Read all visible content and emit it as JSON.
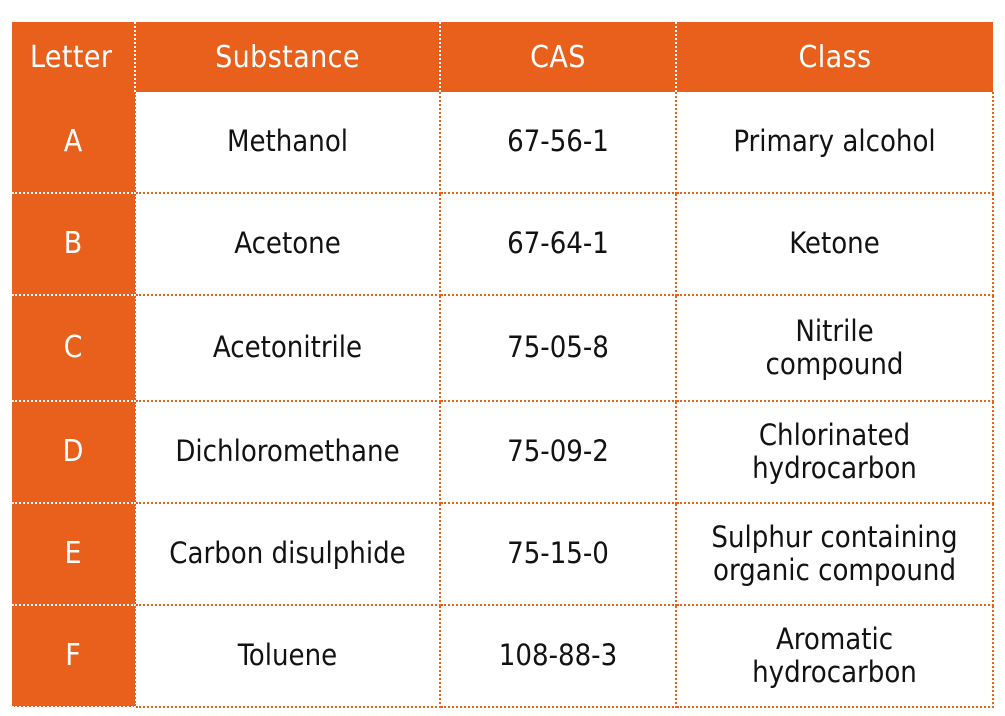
{
  "table": {
    "columns": [
      {
        "key": "letter",
        "label": "Letter"
      },
      {
        "key": "substance",
        "label": "Substance"
      },
      {
        "key": "cas",
        "label": "CAS"
      },
      {
        "key": "class",
        "label": "Class"
      }
    ],
    "header_bg": "#e8601c",
    "header_text_color": "#ffffff",
    "border_color": "#e8601c",
    "rows": [
      {
        "letter": "A",
        "substance": "Methanol",
        "cas": "67-56-1",
        "class_line1": "Primary alcohol",
        "class_line2": ""
      },
      {
        "letter": "B",
        "substance": "Acetone",
        "cas": "67-64-1",
        "class_line1": "Ketone",
        "class_line2": ""
      },
      {
        "letter": "C",
        "substance": "Acetonitrile",
        "cas": "75-05-8",
        "class_line1": "Nitrile",
        "class_line2": "compound"
      },
      {
        "letter": "D",
        "substance": "Dichloromethane",
        "cas": "75-09-2",
        "class_line1": "Chlorinated",
        "class_line2": "hydrocarbon"
      },
      {
        "letter": "E",
        "substance": "Carbon disulphide",
        "cas": "75-15-0",
        "class_line1": "Sulphur containing",
        "class_line2": "organic compound"
      },
      {
        "letter": "F",
        "substance": "Toluene",
        "cas": "108-88-3",
        "class_line1": "Aromatic",
        "class_line2": "hydrocarbon"
      }
    ]
  }
}
